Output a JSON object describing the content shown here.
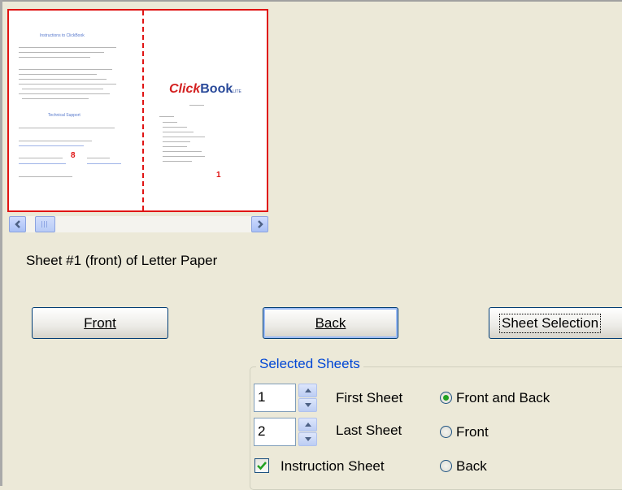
{
  "preview": {
    "left_heading": "Instructions to ClickBook",
    "left_section": "Technical Support",
    "logo_main": "Click",
    "logo_book": "Book",
    "logo_sub": "LITE",
    "left_page_number": "8",
    "right_page_number": "1"
  },
  "sheet_label": "Sheet #1 (front) of Letter Paper",
  "buttons": {
    "front": "Front",
    "back": "Back",
    "sheet_selection": "Sheet Selection"
  },
  "selected_sheets": {
    "title": "Selected Sheets",
    "first_sheet_value": "1",
    "first_sheet_label": "First Sheet",
    "last_sheet_value": "2",
    "last_sheet_label": "Last Sheet",
    "instruction_sheet_label": "Instruction Sheet",
    "instruction_sheet_checked": true,
    "options": [
      {
        "label": "Front and Back",
        "selected": true
      },
      {
        "label": "Front",
        "selected": false
      },
      {
        "label": "Back",
        "selected": false
      }
    ]
  }
}
